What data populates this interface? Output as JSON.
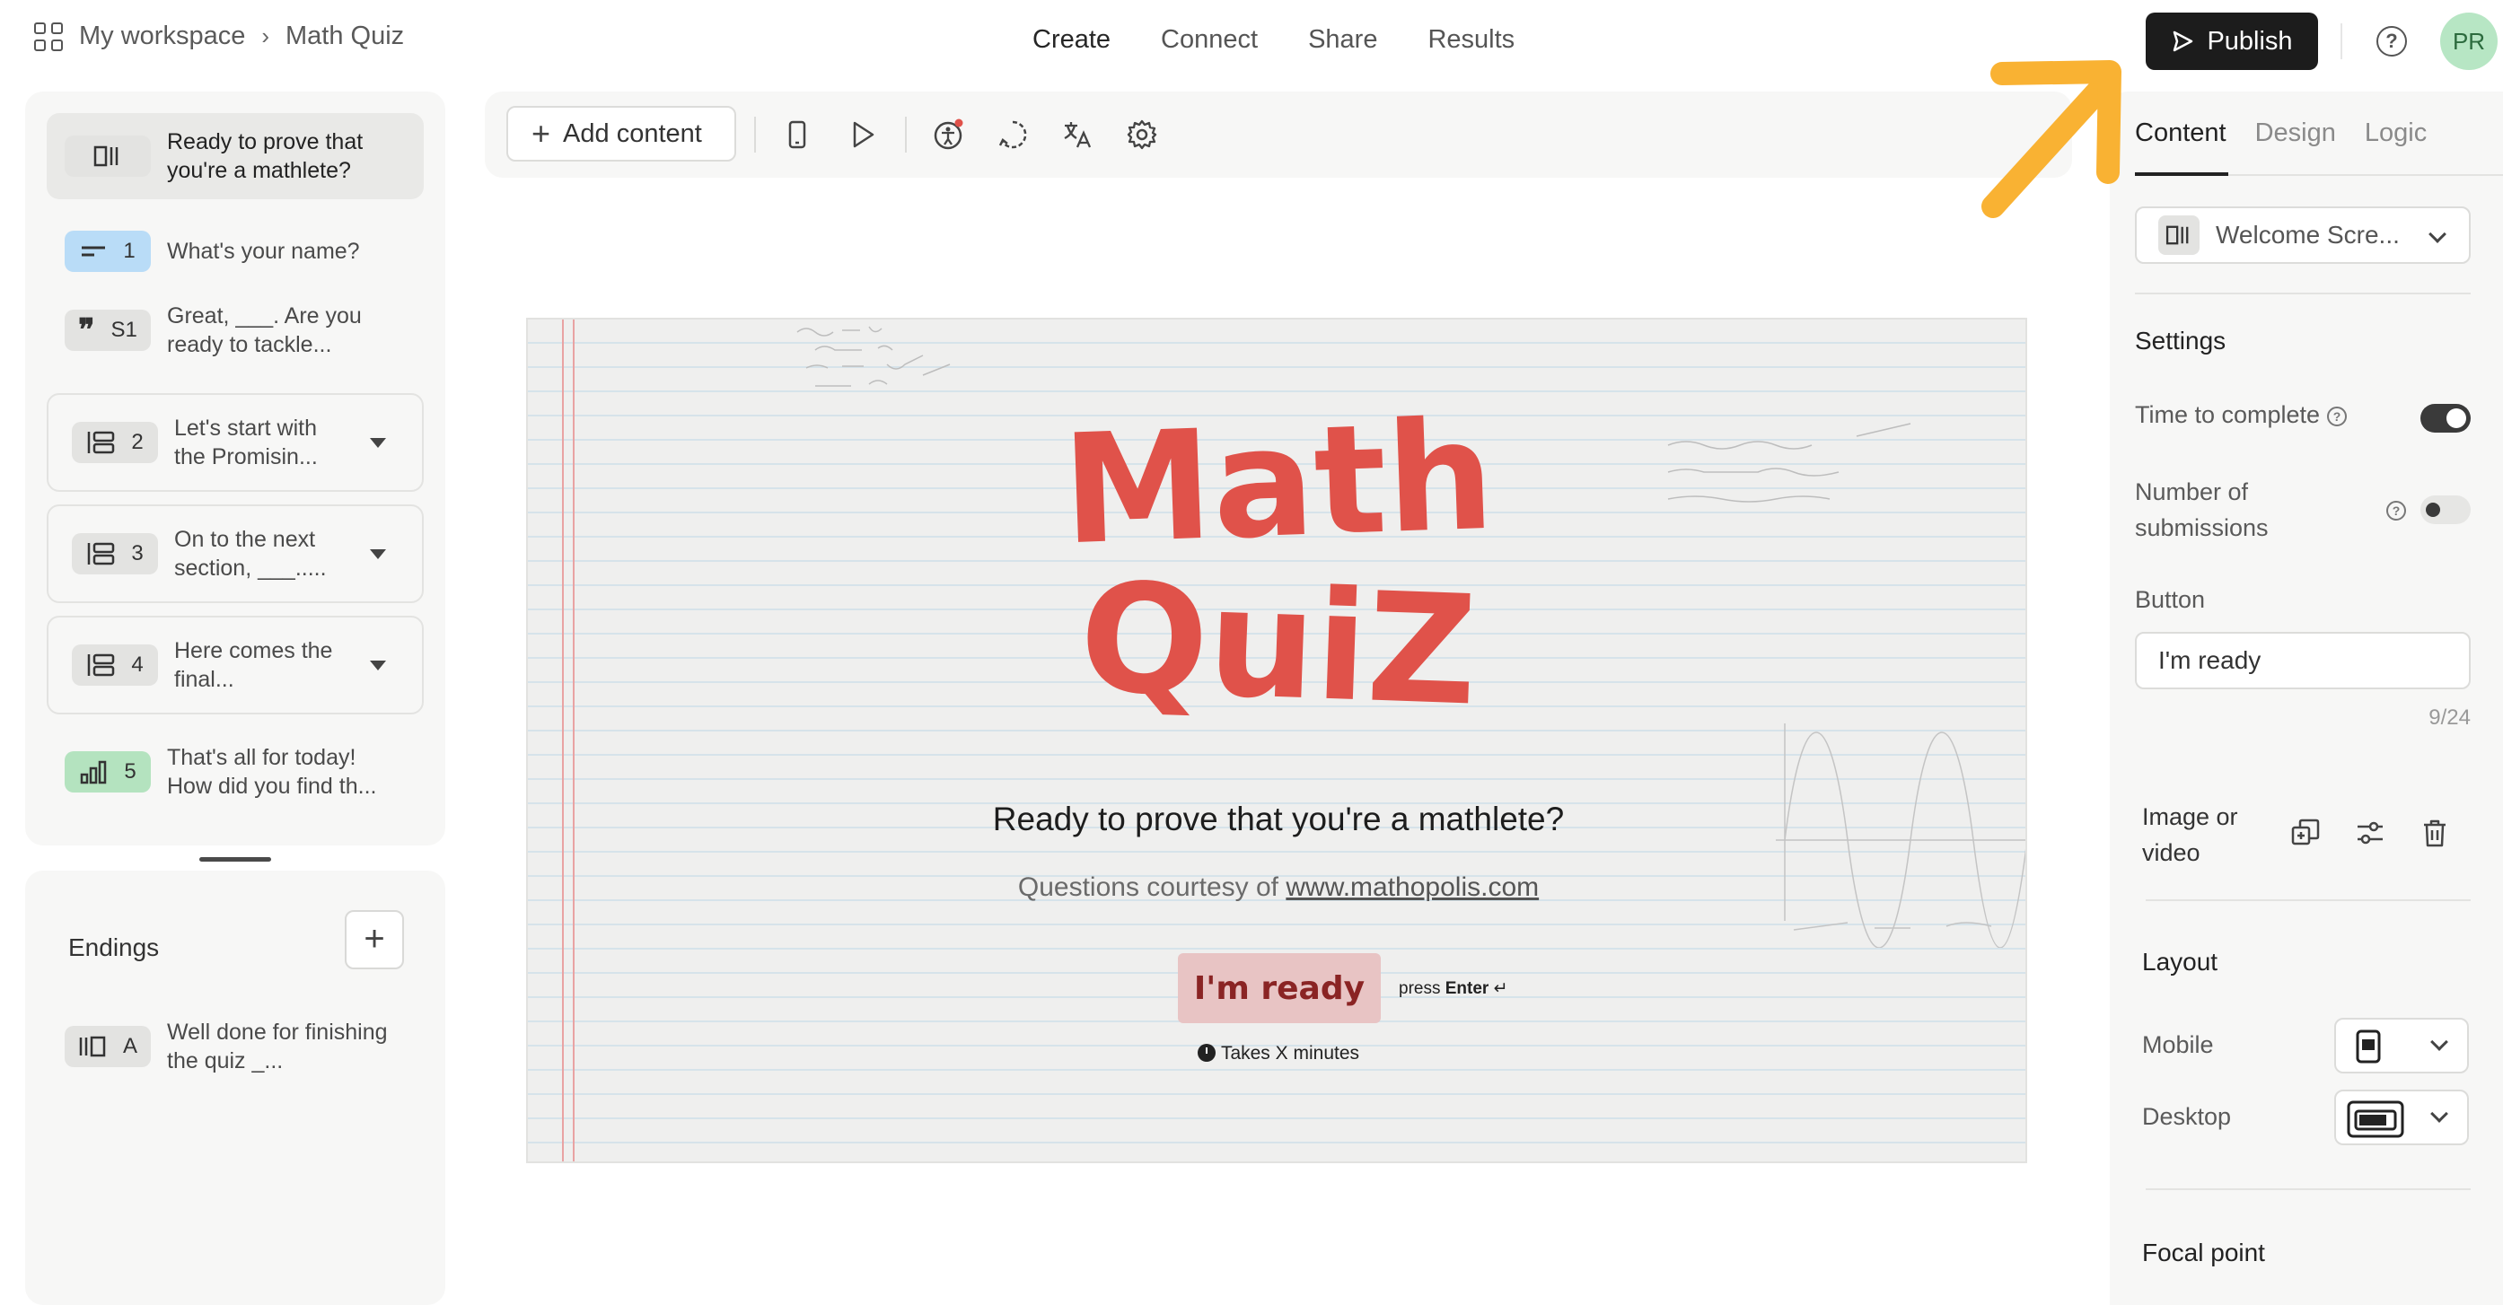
{
  "header": {
    "workspace": "My workspace",
    "form_name": "Math Quiz",
    "nav": [
      "Create",
      "Connect",
      "Share",
      "Results"
    ],
    "publish_label": "Publish",
    "avatar_initials": "PR"
  },
  "sidebar": {
    "questions": [
      {
        "badge": "",
        "label": "Ready to prove that you're a mathlete?",
        "type": "welcome"
      },
      {
        "badge": "1",
        "label": "What's your name?",
        "type": "short-text"
      },
      {
        "badge": "S1",
        "label": "Great, ___. Are you ready to tackle...",
        "type": "statement"
      },
      {
        "badge": "2",
        "label": "Let's start with the Promisin...",
        "type": "group"
      },
      {
        "badge": "3",
        "label": "On to the next section, ___.....",
        "type": "group"
      },
      {
        "badge": "4",
        "label": "Here comes the final...",
        "type": "group"
      },
      {
        "badge": "5",
        "label": "That's all for today! How did you find th...",
        "type": "rating"
      }
    ],
    "endings_title": "Endings",
    "endings": [
      {
        "badge": "A",
        "label": "Well done for finishing the quiz _..."
      }
    ]
  },
  "toolbar": {
    "add_content_label": "Add content"
  },
  "preview": {
    "logo_line1": "Math",
    "logo_line2": "QuiZ",
    "title": "Ready to prove that you're a mathlete?",
    "subtitle_prefix": "Questions courtesy of ",
    "subtitle_link": "www.mathopolis.com",
    "button_label": "I'm ready",
    "press_prefix": "press ",
    "press_key": "Enter",
    "press_symbol": "↵",
    "time_hint": "Takes X minutes"
  },
  "right_panel": {
    "tabs": [
      "Content",
      "Design",
      "Logic"
    ],
    "block_type": "Welcome Scre...",
    "settings_heading": "Settings",
    "time_to_complete": "Time to complete",
    "number_of_submissions_1": "Number of",
    "number_of_submissions_2": "submissions",
    "button_heading": "Button",
    "button_value": "I'm ready",
    "char_count": "9/24",
    "image_or_video_1": "Image or",
    "image_or_video_2": "video",
    "layout_heading": "Layout",
    "mobile_label": "Mobile",
    "desktop_label": "Desktop",
    "focal_point_heading": "Focal point"
  },
  "colors": {
    "accent_arrow": "#f9b233",
    "logo_red": "#e0524a",
    "publish_bg": "#1c1c1c"
  }
}
